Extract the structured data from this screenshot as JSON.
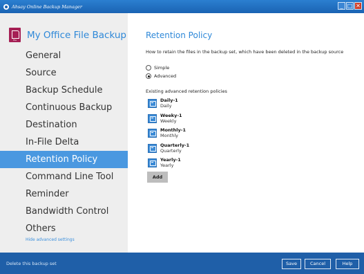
{
  "window": {
    "title": "Ahsay Online Backup Manager",
    "controls": {
      "minimize": "_",
      "maximize": "□",
      "close": "✕"
    }
  },
  "sidebar": {
    "backup_set_name": "My Office File Backup",
    "items": [
      {
        "label": "General"
      },
      {
        "label": "Source"
      },
      {
        "label": "Backup Schedule"
      },
      {
        "label": "Continuous Backup"
      },
      {
        "label": "Destination"
      },
      {
        "label": "In-File Delta"
      },
      {
        "label": "Retention Policy",
        "active": true
      },
      {
        "label": "Command Line Tool"
      },
      {
        "label": "Reminder"
      },
      {
        "label": "Bandwidth Control"
      },
      {
        "label": "Others"
      }
    ],
    "hide_advanced": "Hide advanced settings"
  },
  "main": {
    "title": "Retention Policy",
    "description": "How to retain the files in the backup set, which have been deleted in the backup source",
    "options": [
      {
        "label": "Simple",
        "selected": false
      },
      {
        "label": "Advanced",
        "selected": true
      }
    ],
    "existing_label": "Existing advanced retention policies",
    "policies": [
      {
        "name": "Daily-1",
        "type": "Daily"
      },
      {
        "name": "Weeky-1",
        "type": "Weekly"
      },
      {
        "name": "Monthly-1",
        "type": "Monthly"
      },
      {
        "name": "Quarterly-1",
        "type": "Quarterly"
      },
      {
        "name": "Yearly-1",
        "type": "Yearly"
      }
    ],
    "add_label": "Add"
  },
  "footer": {
    "delete_label": "Delete this backup set",
    "save_label": "Save",
    "cancel_label": "Cancel",
    "help_label": "Help"
  },
  "colors": {
    "accent": "#2e88d8",
    "active_nav": "#4a98e0",
    "footer": "#1f5fa8",
    "title_bar": "#1a63b3"
  }
}
